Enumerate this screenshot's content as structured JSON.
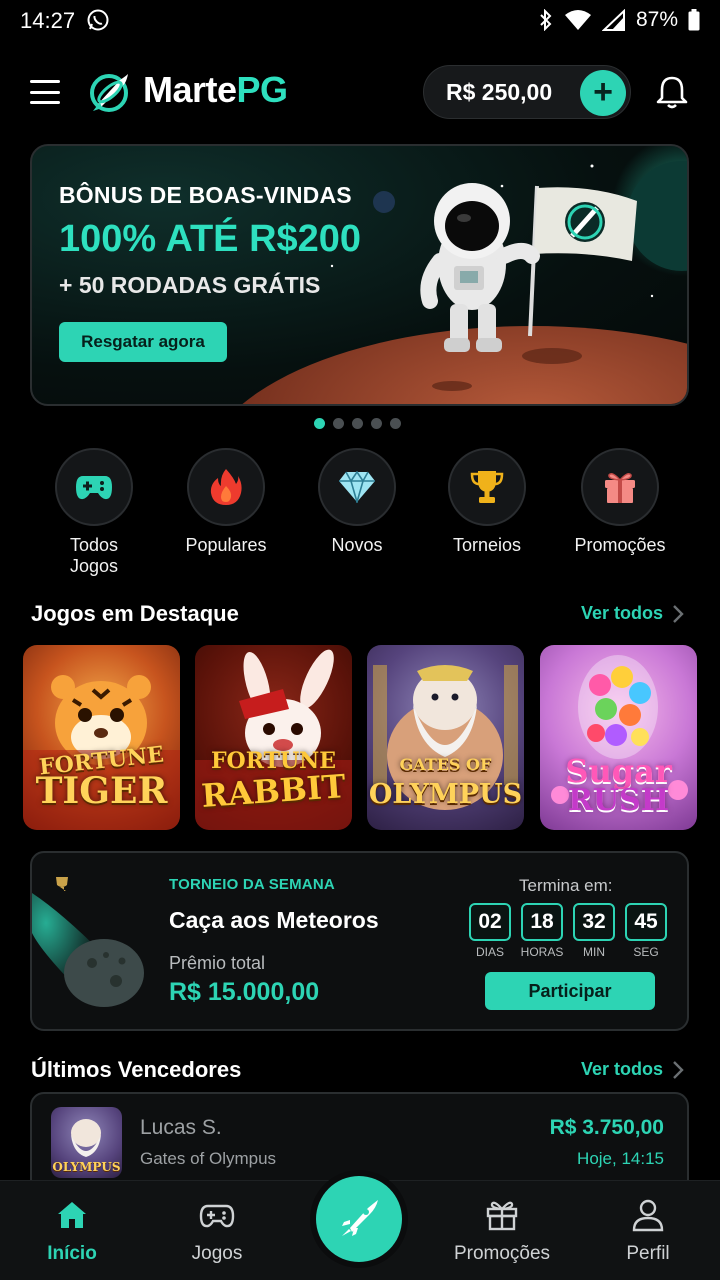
{
  "status_bar": {
    "time": "14:27",
    "battery": "87%"
  },
  "header": {
    "brand_main": "Marte",
    "brand_accent": "PG",
    "balance": "R$ 250,00",
    "add_symbol": "+"
  },
  "banner": {
    "line1": "BÔNUS DE BOAS-VINDAS",
    "line2": "100% ATÉ R$200",
    "line3": "+ 50 RODADAS GRÁTIS",
    "cta": "Resgatar agora",
    "slides_total": 5,
    "slide_active": 1
  },
  "categories": [
    {
      "label": "Todos\nJogos",
      "icon": "gamepad-icon"
    },
    {
      "label": "Populares",
      "icon": "fire-icon"
    },
    {
      "label": "Novos",
      "icon": "diamond-icon"
    },
    {
      "label": "Torneios",
      "icon": "trophy-icon"
    },
    {
      "label": "Promoções",
      "icon": "gift-icon"
    }
  ],
  "featured": {
    "title": "Jogos em Destaque",
    "see_all": "Ver todos",
    "games": [
      {
        "title_top": "FORTUNE",
        "title_bottom": "TIGER"
      },
      {
        "title_top": "FORTUNE",
        "title_bottom": "RABBIT"
      },
      {
        "title_top": "GATES OF",
        "title_bottom": "OLYMPUS"
      },
      {
        "title_top": "Sugar",
        "title_bottom": "RUSH"
      }
    ]
  },
  "tournament": {
    "tag": "TORNEIO DA SEMANA",
    "name": "Caça aos Meteoros",
    "prize_label": "Prêmio total",
    "prize_value": "R$ 15.000,00",
    "ends_label": "Termina em:",
    "countdown": [
      {
        "value": "02",
        "unit": "DIAS"
      },
      {
        "value": "18",
        "unit": "HORAS"
      },
      {
        "value": "32",
        "unit": "MIN"
      },
      {
        "value": "45",
        "unit": "SEG"
      }
    ],
    "cta": "Participar"
  },
  "winners": {
    "title": "Últimos Vencedores",
    "see_all": "Ver todos",
    "items": [
      {
        "name": "Lucas S.",
        "game": "Gates of Olympus",
        "amount": "R$ 3.750,00",
        "time": "Hoje, 14:15",
        "thumb_label": "OLYMPUS"
      }
    ]
  },
  "bottom_nav": [
    {
      "label": "Início",
      "active": true
    },
    {
      "label": "Jogos",
      "active": false
    },
    {
      "label": "Promoções",
      "active": false
    },
    {
      "label": "Perfil",
      "active": false
    }
  ],
  "colors": {
    "accent": "#2dd4b4",
    "background": "#000000",
    "card": "#0d0f10"
  }
}
